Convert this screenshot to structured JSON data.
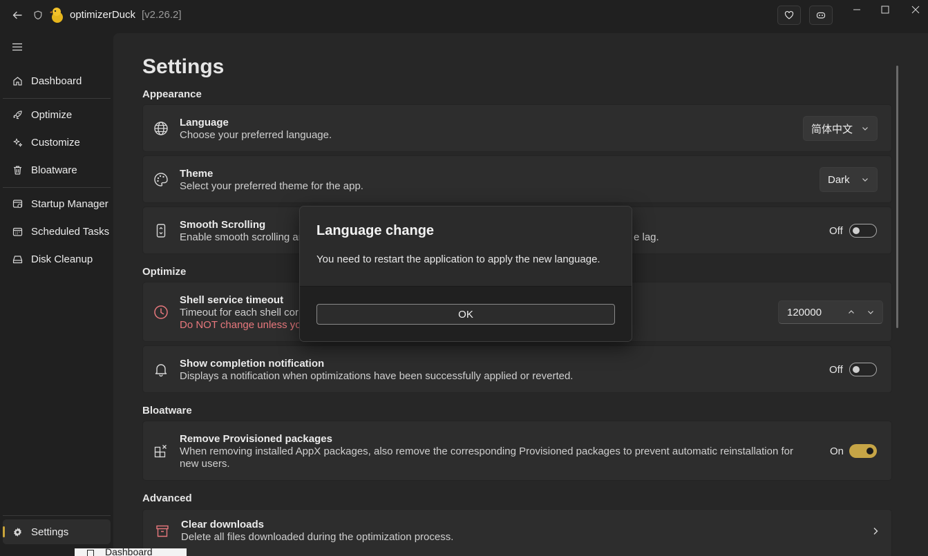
{
  "titlebar": {
    "app_name": "optimizerDuck",
    "version": "[v2.26.2]"
  },
  "sidebar": {
    "items": [
      {
        "label": "Dashboard",
        "icon": "home-icon"
      },
      {
        "label": "Optimize",
        "icon": "rocket-icon"
      },
      {
        "label": "Customize",
        "icon": "sparkle-icon"
      },
      {
        "label": "Bloatware",
        "icon": "trash-icon"
      },
      {
        "label": "Startup Manager",
        "icon": "startup-icon"
      },
      {
        "label": "Scheduled Tasks",
        "icon": "calendar-icon"
      },
      {
        "label": "Disk Cleanup",
        "icon": "drive-icon"
      }
    ],
    "settings_label": "Settings",
    "ghost_label": "Dashboard"
  },
  "page": {
    "title": "Settings",
    "sections": {
      "appearance": "Appearance",
      "optimize": "Optimize",
      "bloatware": "Bloatware",
      "advanced": "Advanced"
    },
    "language": {
      "title": "Language",
      "desc": "Choose your preferred language.",
      "value": "简体中文"
    },
    "theme": {
      "title": "Theme",
      "desc": "Select your preferred theme for the app.",
      "value": "Dark"
    },
    "smooth_scrolling": {
      "title": "Smooth Scrolling",
      "desc_left": "Enable smooth scrolling ar",
      "desc_right": "e lag.",
      "toggle_label": "Off",
      "enabled": false
    },
    "shell_timeout": {
      "title": "Shell service timeout",
      "desc": "Timeout for each shell cor",
      "warning": "Do NOT change unless yo",
      "value": "120000"
    },
    "completion_notification": {
      "title": "Show completion notification",
      "desc": "Displays a notification when optimizations have been successfully applied or reverted.",
      "toggle_label": "Off",
      "enabled": false
    },
    "provisioned": {
      "title": "Remove Provisioned packages",
      "desc_line1": "When removing installed AppX packages, also remove the corresponding Provisioned packages to prevent automatic reinstallation for",
      "desc_line2": "new users.",
      "toggle_label": "On",
      "enabled": true
    },
    "clear_downloads": {
      "title": "Clear downloads",
      "desc": "Delete all files downloaded during the optimization process."
    }
  },
  "dialog": {
    "title": "Language change",
    "message": "You need to restart the application to apply the new language.",
    "ok_label": "OK"
  },
  "colors": {
    "accent": "#c6a546",
    "warning": "#e8787d",
    "background": "#202020",
    "card": "#2d2d2d"
  }
}
